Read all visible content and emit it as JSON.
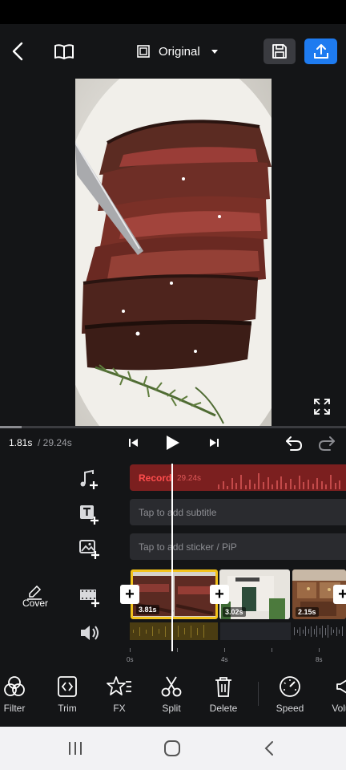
{
  "header": {
    "aspect_ratio_label": "Original"
  },
  "playback": {
    "current_time": "1.81s",
    "total_time": "/ 29.24s",
    "progress": 0.062
  },
  "tracks": {
    "record_label": "Record",
    "record_time": "29.24s",
    "subtitle_placeholder": "Tap to add subtitle",
    "sticker_placeholder": "Tap to add sticker / PiP"
  },
  "cover_label": "Cover",
  "clips": [
    {
      "duration": "3.81s"
    },
    {
      "duration": "3.02s"
    },
    {
      "duration": "2.15s"
    }
  ],
  "ruler": [
    "0s",
    "4s",
    "8s"
  ],
  "toolbar": [
    {
      "label": "Filter",
      "icon": "filter-icon"
    },
    {
      "label": "Trim",
      "icon": "trim-icon"
    },
    {
      "label": "FX",
      "icon": "fx-star-icon"
    },
    {
      "label": "Split",
      "icon": "scissors-icon"
    },
    {
      "label": "Delete",
      "icon": "trash-icon"
    },
    {
      "label": "Speed",
      "icon": "speedometer-icon"
    },
    {
      "label": "Volu",
      "icon": "volume-icon"
    }
  ],
  "colors": {
    "accent": "#1e7bf0",
    "selected_clip_border": "#f2c21b",
    "record_track": "#7b1f1f"
  }
}
